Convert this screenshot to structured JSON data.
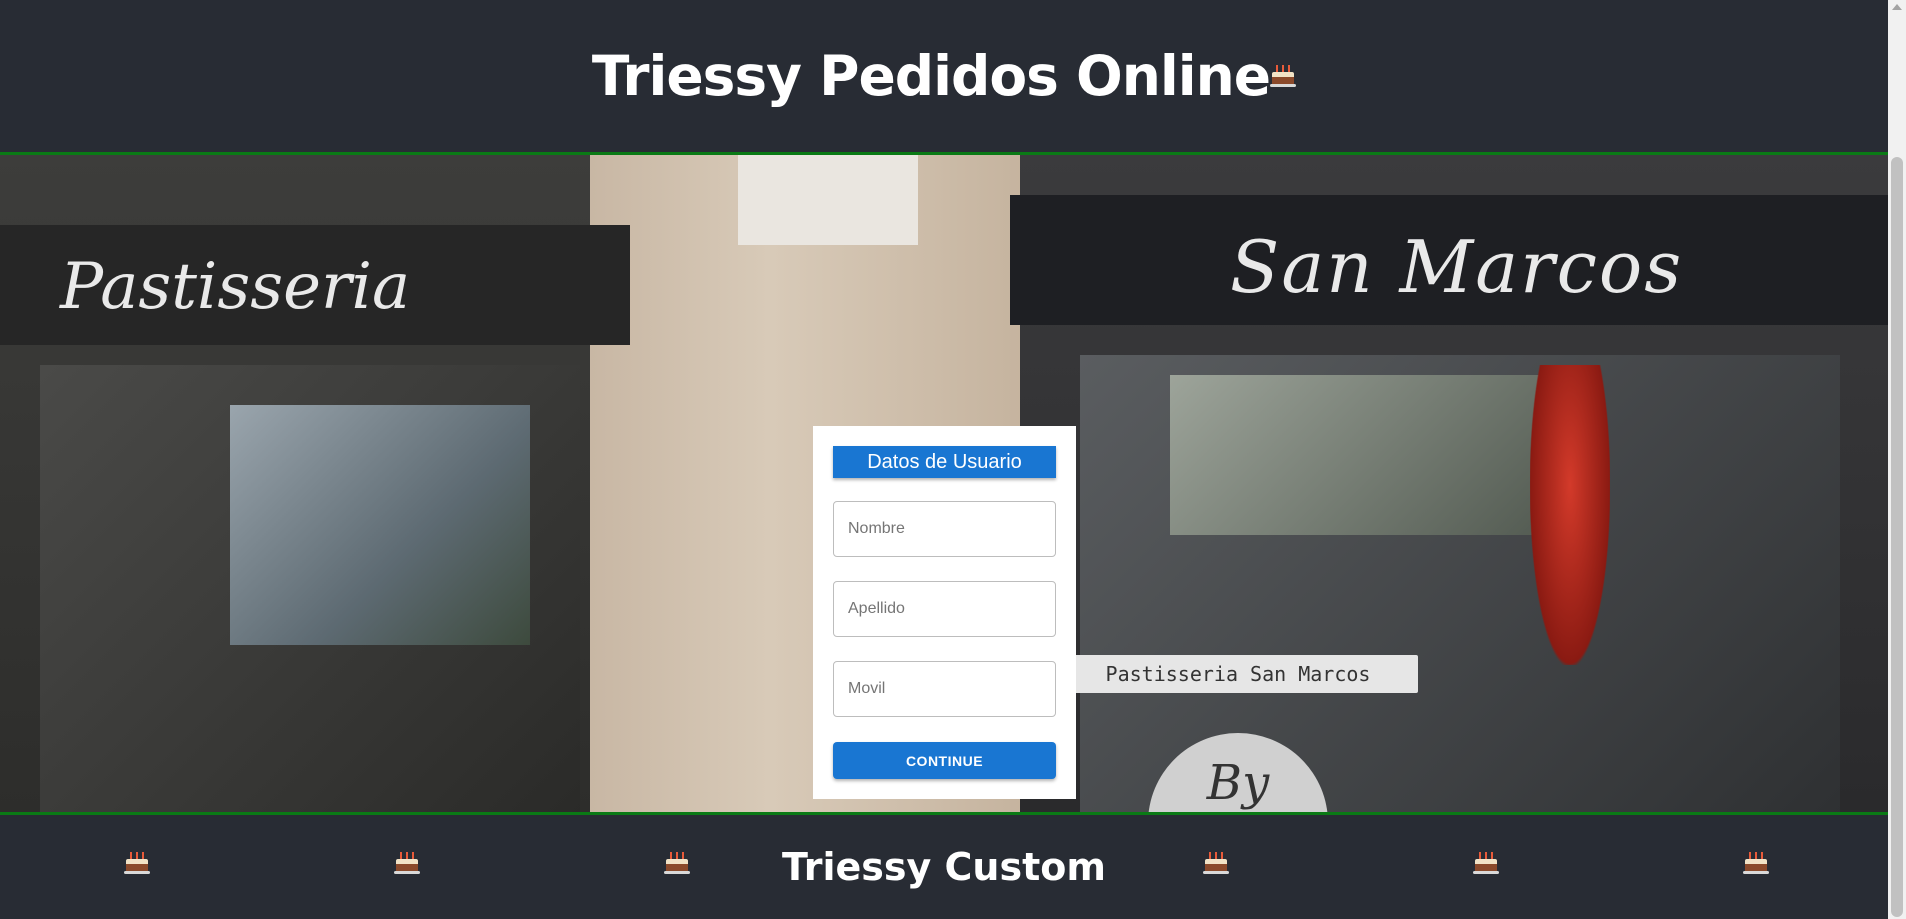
{
  "header": {
    "title": "Triessy Pedidos Online",
    "icon": "cake-icon"
  },
  "hero": {
    "sign_left": "Pastisseria",
    "sign_right": "San Marcos",
    "plaque": "Pastisseria     San Marcos",
    "logo": "By"
  },
  "form": {
    "title": "Datos de Usuario",
    "nombre_placeholder": "Nombre",
    "apellido_placeholder": "Apellido",
    "movil_placeholder": "Movil",
    "continue_label": "CONTINUE",
    "accent": "#1976d2"
  },
  "footer": {
    "title": "Triessy Custom",
    "icon": "cake-icon"
  },
  "colors": {
    "background": "#282c34",
    "border": "#0a7a15"
  }
}
